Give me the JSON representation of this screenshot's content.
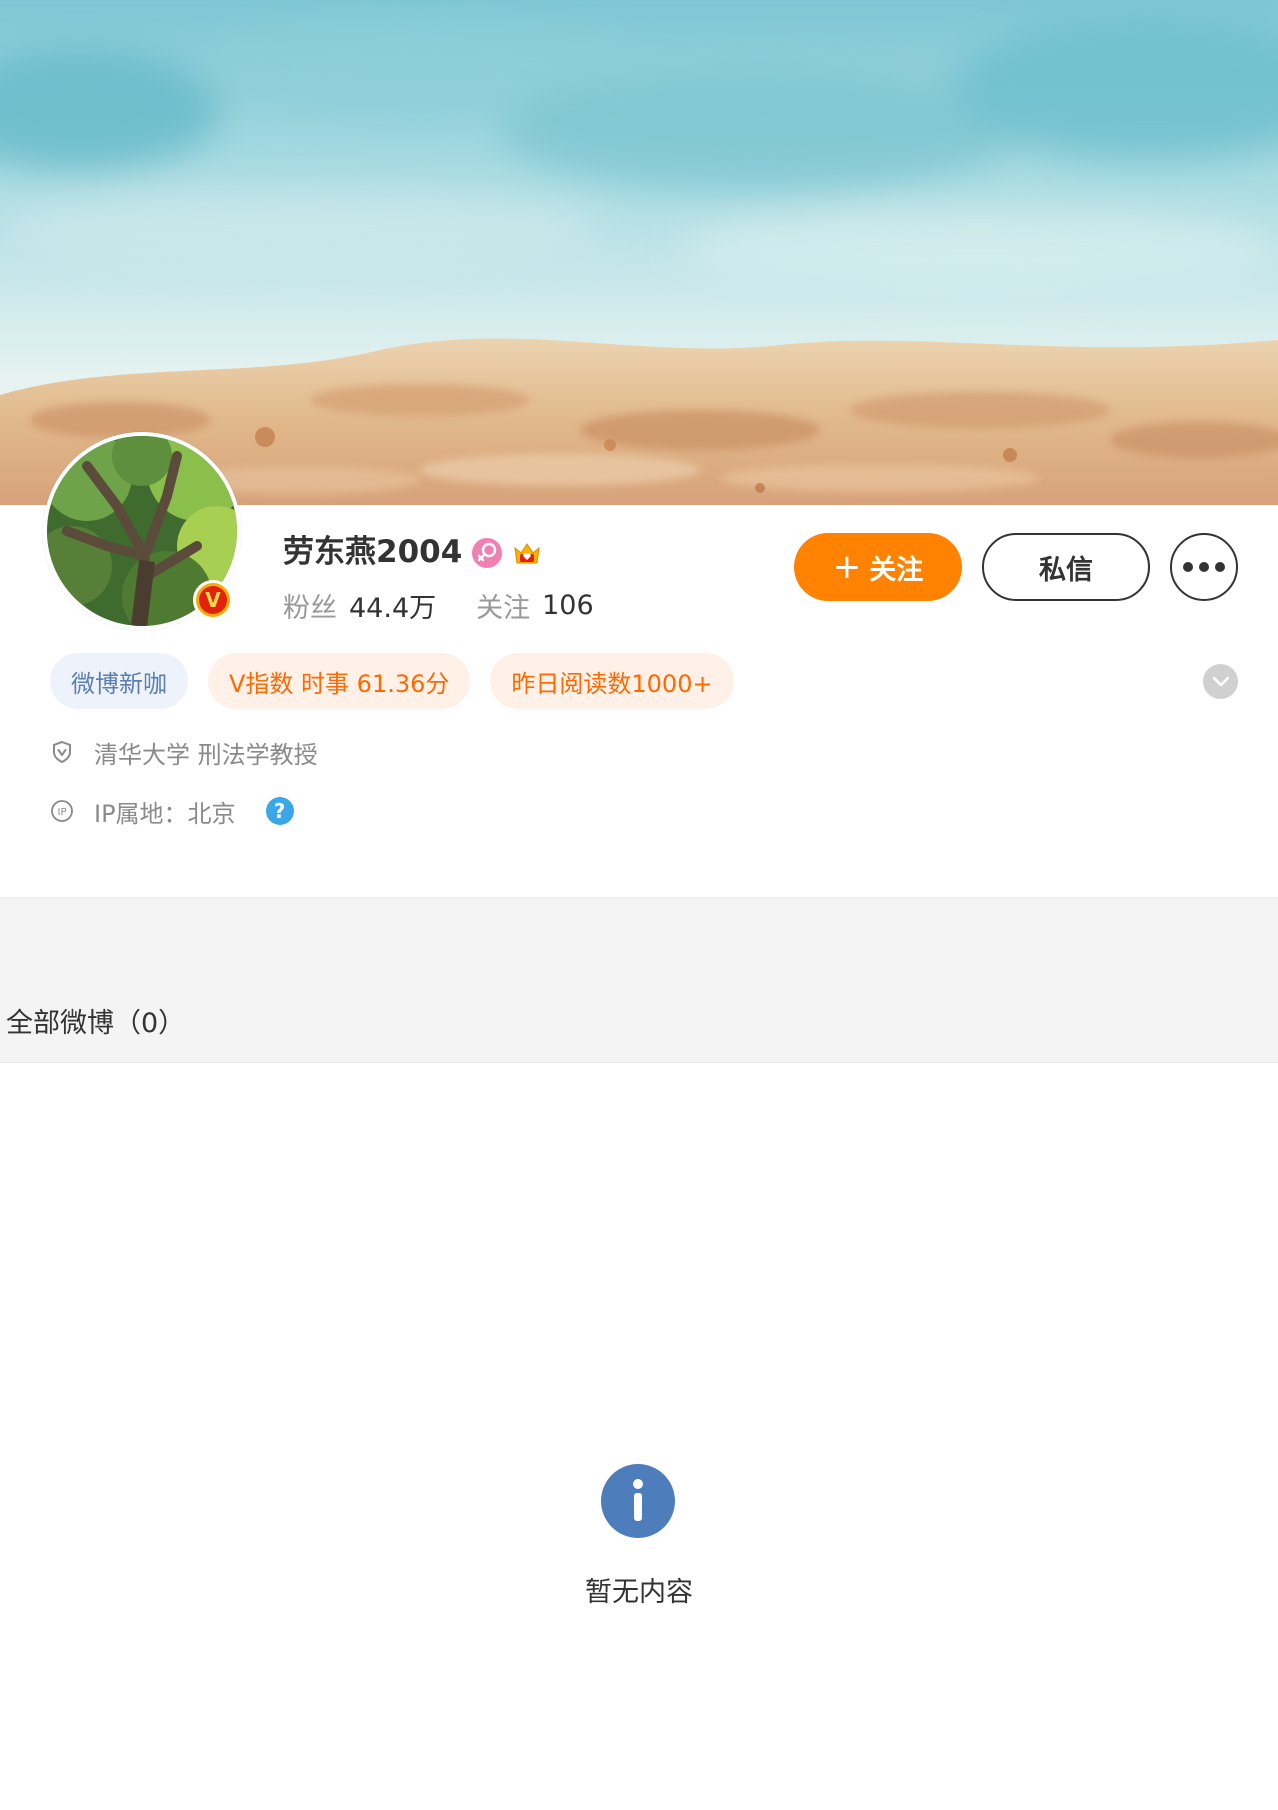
{
  "profile": {
    "name": "劳东燕2004",
    "fans_label": "粉丝",
    "fans_count": "44.4万",
    "following_label": "关注",
    "following_count": "106"
  },
  "badges": {
    "gender_icon": "female-icon",
    "member_icon": "crown-icon",
    "verified_icon": "verified-v-icon",
    "verified_mark": "V"
  },
  "actions": {
    "follow_plus": "+",
    "follow_label": "关注",
    "message_label": "私信",
    "more_icon": "more-dots-icon"
  },
  "tags": [
    {
      "label": "微博新咖",
      "style": "blue"
    },
    {
      "label": "V指数 时事 61.36分",
      "style": "orange"
    },
    {
      "label": "昨日阅读数1000+",
      "style": "orange"
    }
  ],
  "info": {
    "certification": "清华大学 刑法学教授",
    "ip_location": "IP属地：北京",
    "help_mark": "?"
  },
  "feed": {
    "section_title": "全部微博（0）",
    "empty_text": "暂无内容"
  },
  "colors": {
    "accent_orange": "#ff8200",
    "tag_blue_text": "#5b7fb3",
    "tag_orange_text": "#ff6a00",
    "info_icon_blue": "#4e7dbb",
    "help_blue": "#3aa7e8"
  }
}
